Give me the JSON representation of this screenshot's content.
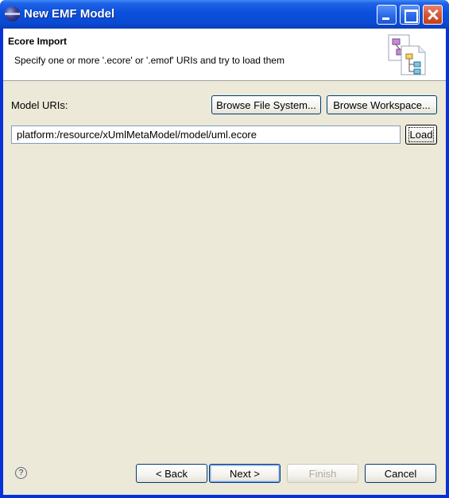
{
  "window": {
    "title": "New EMF Model"
  },
  "header": {
    "title": "Ecore Import",
    "description": "Specify one or more '.ecore' or '.emof' URIs and try to load them"
  },
  "form": {
    "model_uris_label": "Model URIs:",
    "browse_file_system_label": "Browse File System...",
    "browse_workspace_label": "Browse Workspace...",
    "uri_value": "platform:/resource/xUmlMetaModel/model/uml.ecore",
    "load_label": "Load"
  },
  "footer": {
    "help_glyph": "?",
    "back_label": "< Back",
    "next_label": "Next >",
    "finish_label": "Finish",
    "cancel_label": "Cancel"
  }
}
